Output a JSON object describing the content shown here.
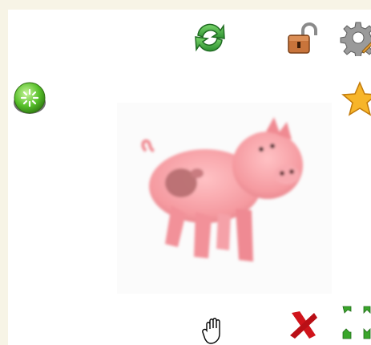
{
  "app": {
    "background": "#f7f4e6",
    "panel_background": "#ffffff"
  },
  "toolbar_top": {
    "icons": [
      "refresh-icon",
      "unlock-icon",
      "settings-icon"
    ]
  },
  "left_controls": {
    "icons": [
      "green-power-button-icon"
    ]
  },
  "right_controls": {
    "icons": [
      "star-icon"
    ]
  },
  "main_image": {
    "subject": "pig",
    "colors": {
      "body": "#f59aa0",
      "spot": "#b56b6e"
    }
  },
  "toolbar_bottom": {
    "icons": [
      "hand-cursor-icon",
      "close-icon",
      "move-arrows-icon"
    ],
    "close_color": "#d0141b"
  }
}
